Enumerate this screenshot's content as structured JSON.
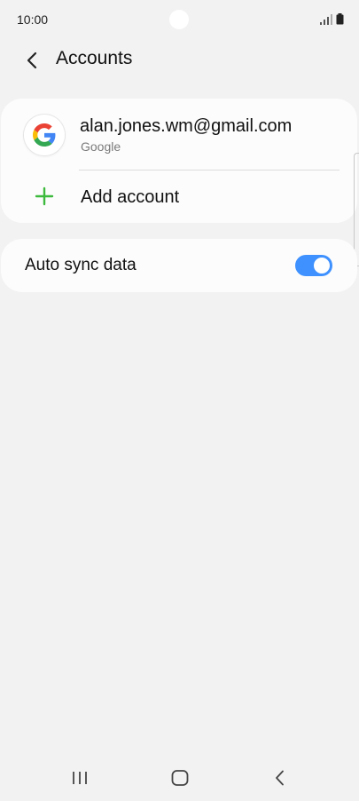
{
  "status_bar": {
    "time": "10:00",
    "signal_icon": "signal-icon",
    "battery_icon": "battery-icon"
  },
  "header": {
    "back_icon": "back-arrow-icon",
    "title": "Accounts"
  },
  "accounts": [
    {
      "icon": "google-logo-icon",
      "email": "alan.jones.wm@gmail.com",
      "provider": "Google"
    }
  ],
  "add_account": {
    "icon": "plus-icon",
    "label": "Add account"
  },
  "auto_sync": {
    "label": "Auto sync data",
    "enabled": true
  },
  "navigation": {
    "recents_icon": "recents-icon",
    "home_icon": "home-icon",
    "back_icon": "nav-back-icon"
  },
  "colors": {
    "accent": "#3e91ff",
    "add_icon": "#3dba3d",
    "background": "#f2f2f2",
    "card": "#fcfcfc"
  }
}
